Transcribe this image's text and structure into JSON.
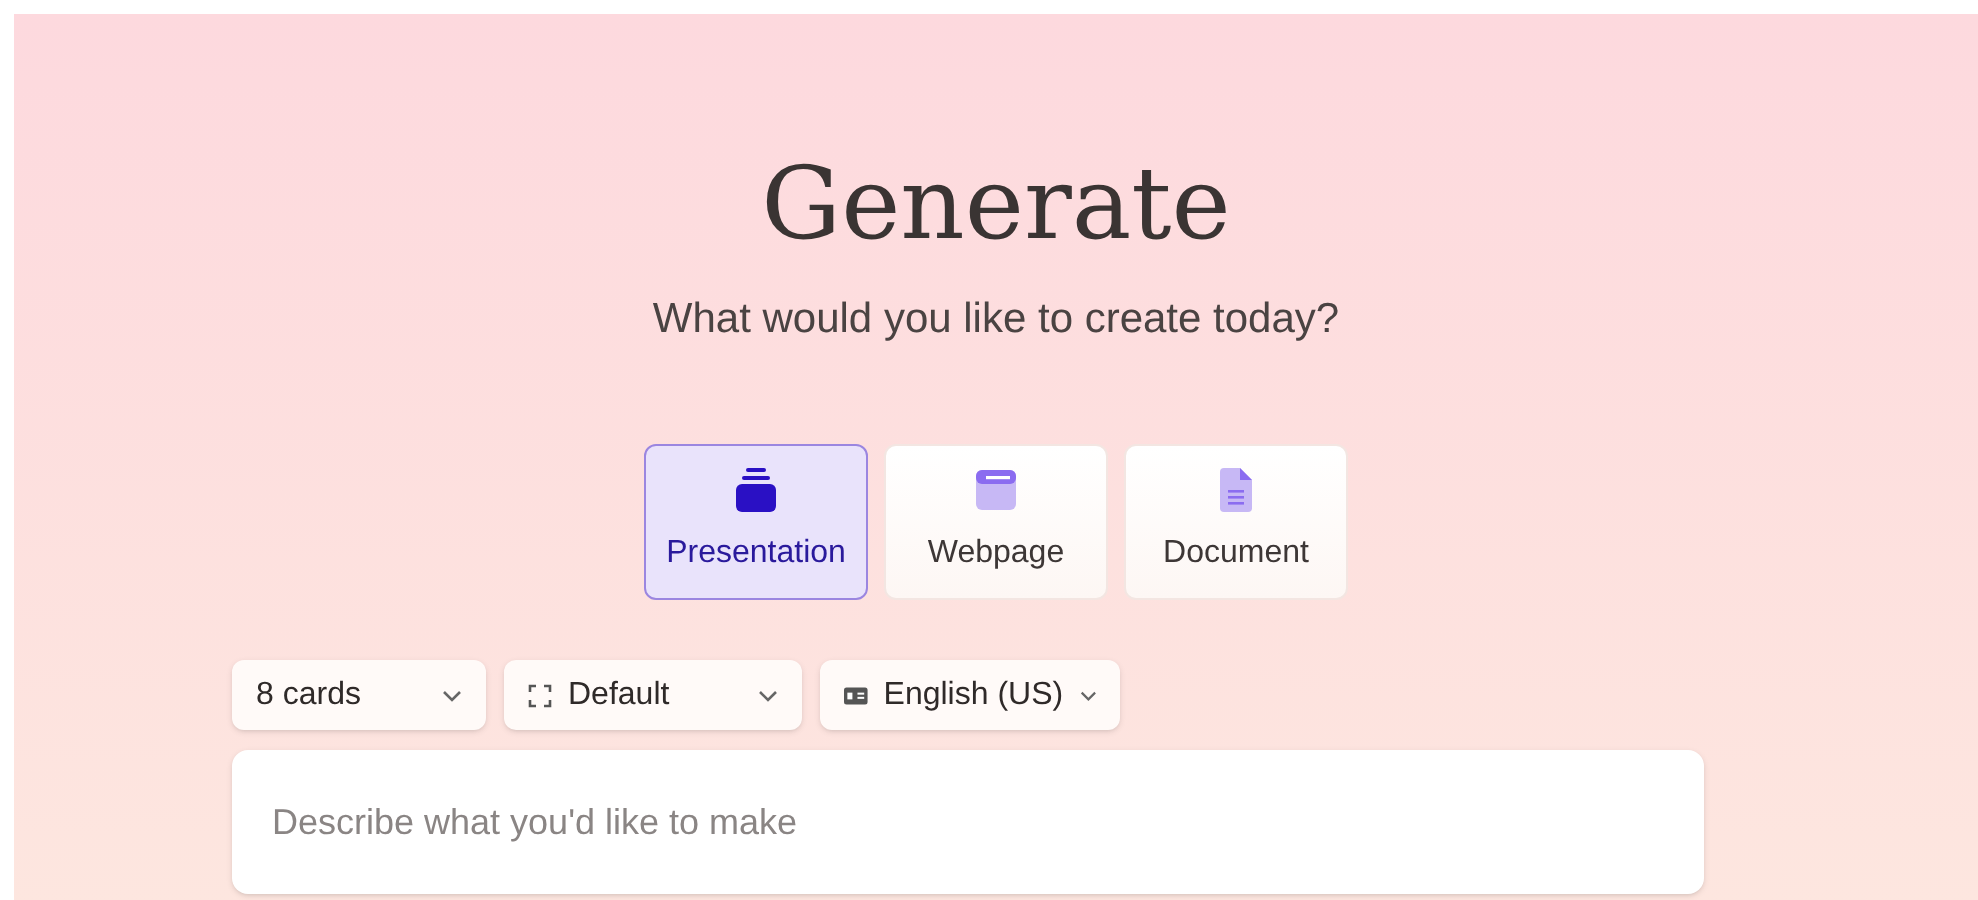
{
  "title": "Generate",
  "subtitle": "What would you like to create today?",
  "types": [
    {
      "kind": "presentation",
      "label": "Presentation",
      "selected": true
    },
    {
      "kind": "webpage",
      "label": "Webpage",
      "selected": false
    },
    {
      "kind": "document",
      "label": "Document",
      "selected": false
    }
  ],
  "options": [
    {
      "kind": "plain",
      "label": "8 cards"
    },
    {
      "kind": "frame",
      "label": "Default"
    },
    {
      "kind": "language",
      "label": "English (US)"
    }
  ],
  "prompt": {
    "placeholder": "Describe what you'd like to make"
  }
}
